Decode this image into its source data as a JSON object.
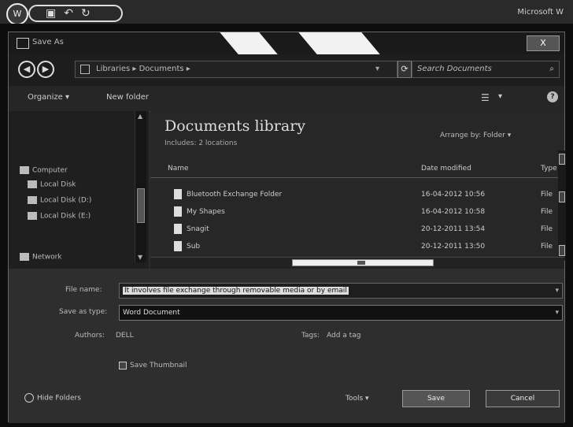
{
  "word": {
    "title": "Microsoft W"
  },
  "dialog": {
    "title": "Save As",
    "close": "X",
    "address": {
      "path": "Libraries ▸ Documents ▸"
    },
    "search_placeholder": "Search Documents",
    "toolbar": {
      "organize": "Organize ▾",
      "new_folder": "New folder"
    },
    "nav": {
      "items": [
        {
          "label": "Computer",
          "name": "nav-computer"
        },
        {
          "label": "Local Disk",
          "name": "nav-local-disk"
        },
        {
          "label": "Local Disk (D:)",
          "name": "nav-disk-d"
        },
        {
          "label": "Local Disk (E:)",
          "name": "nav-disk-e"
        },
        {
          "label": "Network",
          "name": "nav-network"
        }
      ]
    },
    "library": {
      "title": "Documents library",
      "subtitle": "Includes: 2 locations",
      "arrange_label": "Arrange by:",
      "arrange_value": "Folder ▾"
    },
    "columns": {
      "name": "Name",
      "date": "Date modified",
      "type": "Type"
    },
    "files": [
      {
        "name": "Bluetooth Exchange Folder",
        "date": "16-04-2012 10:56",
        "type": "File"
      },
      {
        "name": "My Shapes",
        "date": "16-04-2012 10:58",
        "type": "File"
      },
      {
        "name": "Snagit",
        "date": "20-12-2011 13:54",
        "type": "File"
      },
      {
        "name": "Sub",
        "date": "20-12-2011 13:50",
        "type": "File"
      }
    ],
    "form": {
      "file_name_label": "File name:",
      "file_name_value": "It involves file exchange through removable media or by email",
      "save_type_label": "Save as type:",
      "save_type_value": "Word Document",
      "authors_label": "Authors:",
      "authors_value": "DELL",
      "tags_label": "Tags:",
      "tags_value": "Add a tag",
      "thumbnail_label": "Save Thumbnail",
      "hide_folders": "Hide Folders",
      "tools": "Tools ▾",
      "save": "Save",
      "cancel": "Cancel"
    }
  }
}
